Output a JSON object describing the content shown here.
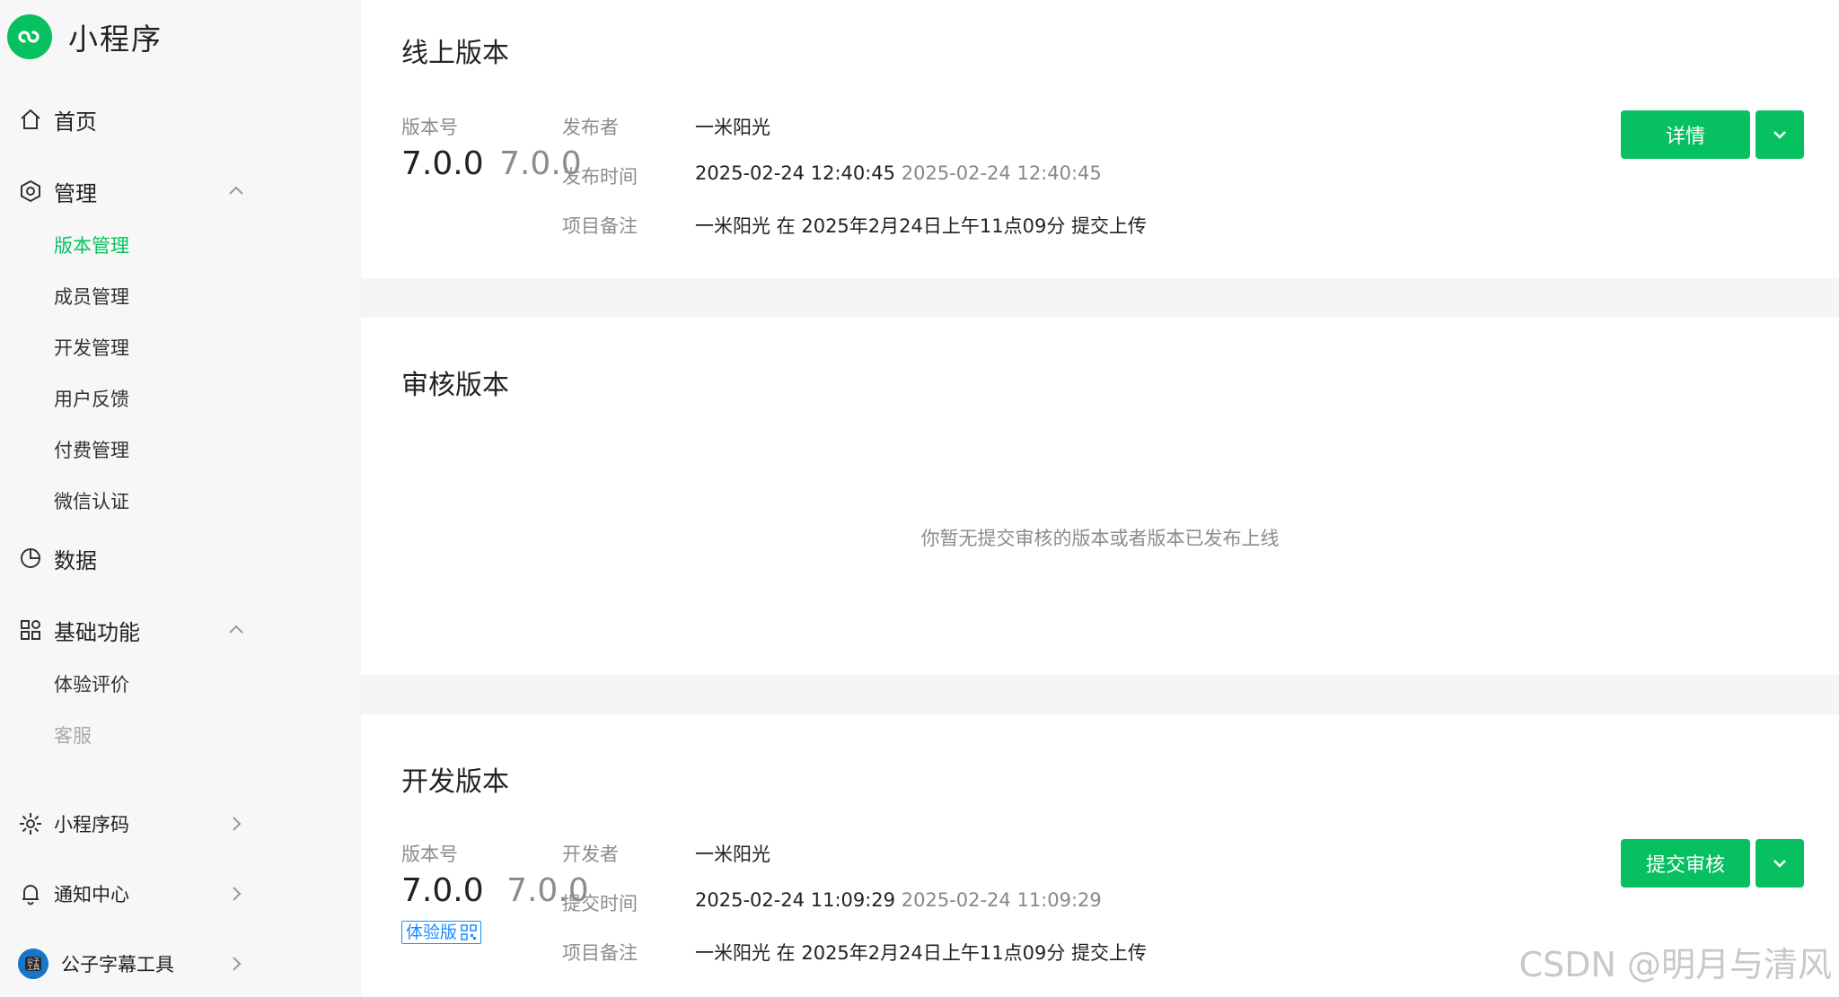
{
  "brand": {
    "name": "小程序"
  },
  "sidebar": {
    "home": "首页",
    "manage": {
      "label": "管理",
      "items": [
        "版本管理",
        "成员管理",
        "开发管理",
        "用户反馈",
        "付费管理",
        "微信认证"
      ]
    },
    "data": "数据",
    "basic": {
      "label": "基础功能",
      "items": [
        "体验评价",
        "客服"
      ]
    },
    "qrcode": "小程序码",
    "notify": "通知中心",
    "account": {
      "name": "公子字幕工具",
      "avatar_text": "公子 工具"
    }
  },
  "online": {
    "title": "线上版本",
    "version_label": "版本号",
    "version": "7.0.0",
    "version_dim": "7.0.0",
    "publisher_label": "发布者",
    "publisher": "一米阳光",
    "time_label": "发布时间",
    "time": "2025-02-24 12:40:45",
    "time_dim": "2025-02-24 12:40:45",
    "note_label": "项目备注",
    "note": "一米阳光 在 2025年2月24日上午11点09分 提交上传",
    "detail_button": "详情"
  },
  "review": {
    "title": "审核版本",
    "empty": "你暂无提交审核的版本或者版本已发布上线"
  },
  "dev": {
    "title": "开发版本",
    "version_label": "版本号",
    "version": "7.0.0",
    "version_dim": "7.0.0",
    "badge": "体验版",
    "developer_label": "开发者",
    "developer": "一米阳光",
    "time_label": "提交时间",
    "time": "2025-02-24 11:09:29",
    "time_dim": "2025-02-24 11:09:29",
    "note_label": "项目备注",
    "note": "一米阳光 在 2025年2月24日上午11点09分 提交上传",
    "submit_button": "提交审核"
  },
  "watermark": "CSDN @明月与清风",
  "colors": {
    "accent": "#07c160",
    "badge": "#1a8cff"
  }
}
